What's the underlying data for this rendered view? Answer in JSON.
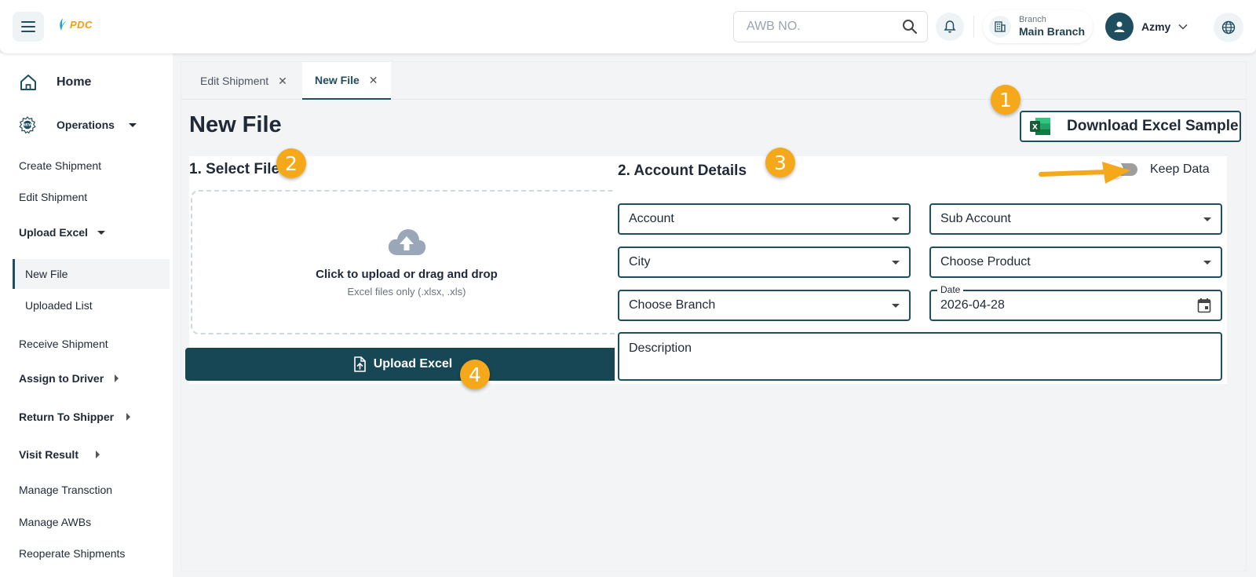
{
  "app": {
    "logo_text": "PDC"
  },
  "header": {
    "search_placeholder": "AWB NO.",
    "branch_label": "Branch",
    "branch_name": "Main Branch",
    "user_name": "Azmy"
  },
  "sidebar": {
    "home": "Home",
    "operations": "Operations",
    "items": {
      "create_shipment": "Create Shipment",
      "edit_shipment": "Edit Shipment",
      "upload_excel": "Upload Excel",
      "new_file": "New File",
      "uploaded_list": "Uploaded List",
      "receive_shipment": "Receive Shipment",
      "assign_to_driver": "Assign to Driver",
      "return_to_shipper": "Return To Shipper",
      "visit_result": "Visit Result",
      "manage_transaction": "Manage Transction",
      "manage_awbs": "Manage AWBs",
      "reoperate_shipments": "Reoperate Shipments"
    }
  },
  "tabs": [
    {
      "label": "Edit Shipment",
      "active": false
    },
    {
      "label": "New File",
      "active": true
    }
  ],
  "page": {
    "title": "New File",
    "download_sample_label": "Download Excel Sample"
  },
  "select_file": {
    "title": "1. Select File",
    "dropzone_title": "Click to upload or drag and drop",
    "dropzone_subtitle": "Excel files only (.xlsx, .xls)",
    "upload_button": "Upload Excel"
  },
  "account_details": {
    "title": "2. Account Details",
    "keep_data_label": "Keep Data",
    "keep_data_on": false,
    "account": "Account",
    "sub_account": "Sub Account",
    "city": "City",
    "choose_product": "Choose Product",
    "choose_branch": "Choose Branch",
    "date_label": "Date",
    "date_value": "2026-04-28",
    "description_placeholder": "Description"
  },
  "annotations": [
    "1",
    "2",
    "3",
    "4"
  ],
  "colors": {
    "primary": "#1f4e5f",
    "upload_button": "#174754",
    "accent": "#f5a81a",
    "logo": "#f59e0b",
    "excel_green": "#1d6f42"
  }
}
